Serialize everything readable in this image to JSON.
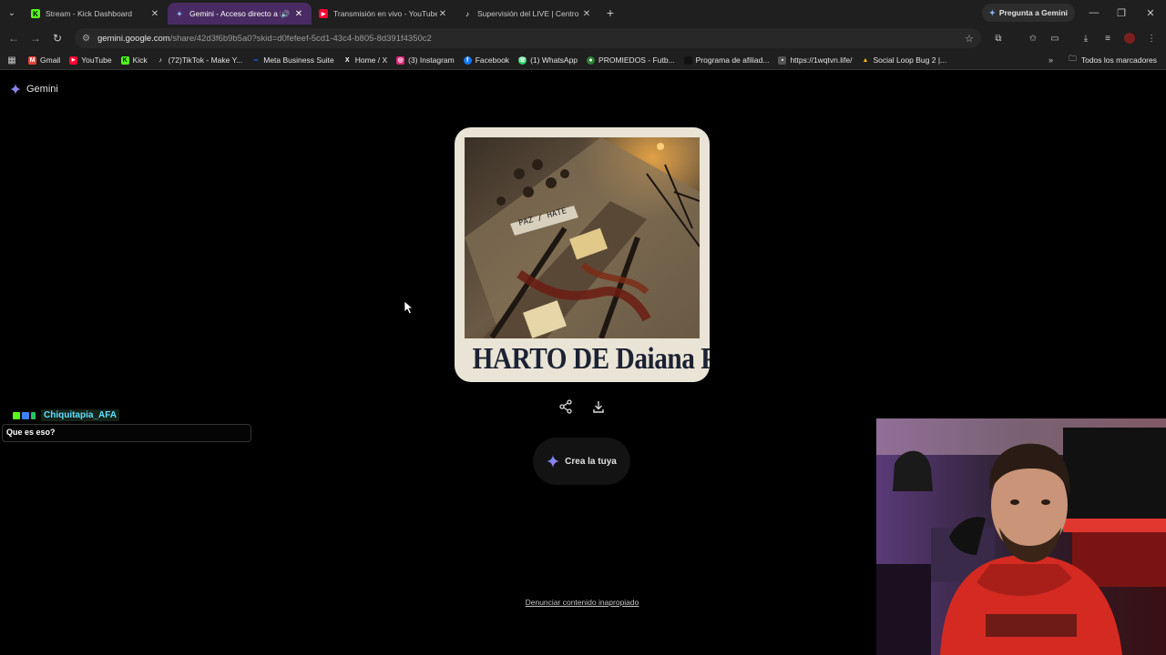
{
  "browser": {
    "tabs": [
      {
        "title": "Stream - Kick Dashboard",
        "favicon": "kick-icon",
        "color": "#53fc18",
        "active": false
      },
      {
        "title": "Gemini - Acceso directo a la",
        "favicon": "gemini-icon",
        "color": "#8ab4f8",
        "active": true,
        "audio": true
      },
      {
        "title": "Transmisión en vivo - YouTube",
        "favicon": "youtube-icon",
        "color": "#ff0033",
        "active": false
      },
      {
        "title": "Supervisión del LIVE | Centro LIVE",
        "favicon": "tiktok-icon",
        "color": "#ffffff",
        "active": false
      }
    ],
    "ask_gemini_label": "Pregunta a Gemini",
    "url_host": "gemini.google.com",
    "url_path": "/share/42d3f6b9b5a0?skid=d0fefeef-5cd1-43c4-b805-8d391f4350c2",
    "bookmarks": [
      {
        "label": "Gmail",
        "icon": "gmail-icon",
        "color": "#ea4335"
      },
      {
        "label": "YouTube",
        "icon": "youtube-icon",
        "color": "#ff0033"
      },
      {
        "label": "Kick",
        "icon": "kick-icon",
        "color": "#53fc18"
      },
      {
        "label": "(72)TikTok - Make Y...",
        "icon": "tiktok-icon",
        "color": "#333333"
      },
      {
        "label": "Meta Business Suite",
        "icon": "meta-icon",
        "color": "#0866ff"
      },
      {
        "label": "Home / X",
        "icon": "x-icon",
        "color": "#333333"
      },
      {
        "label": "(3) Instagram",
        "icon": "instagram-icon",
        "color": "#d62976"
      },
      {
        "label": "Facebook",
        "icon": "facebook-icon",
        "color": "#1877f2"
      },
      {
        "label": "(1) WhatsApp",
        "icon": "whatsapp-icon",
        "color": "#25d366"
      },
      {
        "label": "PROMIEDOS - Futb...",
        "icon": "promiedos-icon",
        "color": "#2e7d32"
      },
      {
        "label": "Programa de afiliad...",
        "icon": "page-icon",
        "color": "#111111"
      },
      {
        "label": "https://1wqtvn.life/",
        "icon": "page-icon",
        "color": "#555555"
      },
      {
        "label": "Social Loop Bug 2 |...",
        "icon": "drive-icon",
        "color": "#fbbc04"
      }
    ],
    "all_bookmarks_label": "Todos los marcadores"
  },
  "page": {
    "brand": "Gemini",
    "card_headline": "HARTO DE Daiana Paz",
    "card_tape_label": "PAZ / HATE",
    "create_button": "Crea la tuya",
    "report_link": "Denunciar contenido inapropiado"
  },
  "overlay": {
    "chat_user": "Chiquitapia_AFA",
    "chat_message": "Que es eso?"
  },
  "colors": {
    "accent_tab": "#4a2a63",
    "card_bg": "#e9e4d6",
    "headline": "#1c2233",
    "kick_green": "#53fc18"
  }
}
